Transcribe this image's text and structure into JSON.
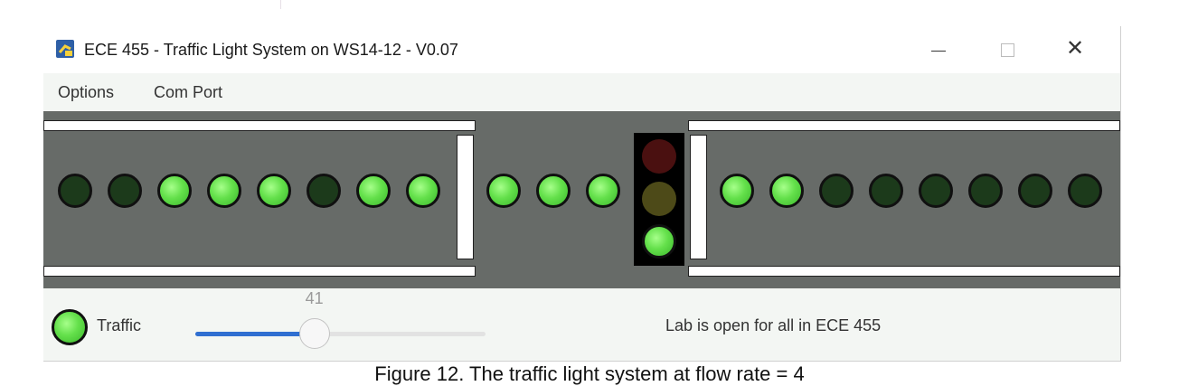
{
  "window": {
    "title": "ECE 455 - Traffic Light System on WS14-12 - V0.07",
    "icon": "python-app-icon",
    "controls": [
      "minimize-icon",
      "maximize-icon",
      "close-icon"
    ],
    "close_glyph": "✕"
  },
  "menu": {
    "items": [
      {
        "label": "Options"
      },
      {
        "label": "Com Port"
      }
    ]
  },
  "road": {
    "left_lamps": [
      "off",
      "off",
      "on",
      "on",
      "on",
      "off",
      "on",
      "on"
    ],
    "middle_lamps": [
      "on",
      "on",
      "on"
    ],
    "right_lamps": [
      "on",
      "on",
      "off",
      "off",
      "off",
      "off",
      "off",
      "off"
    ],
    "colors": {
      "road": "#676b68",
      "lamp_on": "#64e04b",
      "lamp_off": "#1c3a1b"
    }
  },
  "signal": {
    "state": "green",
    "lights": [
      "red-dim",
      "yellow-dim",
      "green-on"
    ]
  },
  "status": {
    "indicator_state": "on",
    "label": "Traffic",
    "slider_value": "41",
    "slider_min": 0,
    "slider_max": 100,
    "message": "Lab is open for all in ECE 455"
  },
  "caption": {
    "text": "Figure 12. The traffic light system at flow rate = 4"
  }
}
